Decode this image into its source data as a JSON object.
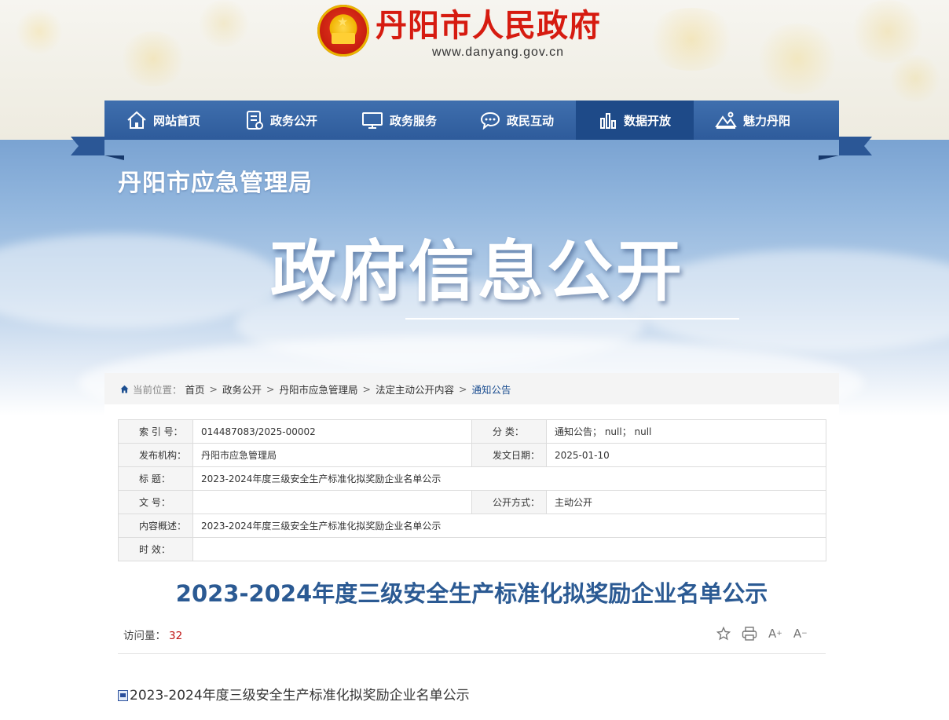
{
  "header": {
    "site_title": "丹阳市人民政府",
    "site_url": "www.danyang.gov.cn",
    "emblem_icon": "national-emblem-icon"
  },
  "nav": {
    "items": [
      {
        "label": "网站首页",
        "icon": "home-icon",
        "active": false
      },
      {
        "label": "政务公开",
        "icon": "document-icon",
        "active": false
      },
      {
        "label": "政务服务",
        "icon": "monitor-icon",
        "active": false
      },
      {
        "label": "政民互动",
        "icon": "chat-bubble-icon",
        "active": false
      },
      {
        "label": "数据开放",
        "icon": "bar-chart-icon",
        "active": true
      },
      {
        "label": "魅力丹阳",
        "icon": "landscape-icon",
        "active": false
      }
    ],
    "bg_color": "#2e5b9b",
    "active_color": "#1e4a88"
  },
  "banner": {
    "bureau_name": "丹阳市应急管理局",
    "title": "政府信息公开"
  },
  "breadcrumb": {
    "label": "当前位置：",
    "items": [
      "首页",
      "政务公开",
      "丹阳市应急管理局",
      "法定主动公开内容"
    ],
    "separator": ">",
    "current": "通知公告"
  },
  "meta": {
    "index_label": "索 引 号：",
    "index_value": "014487083/2025-00002",
    "category_label": "分 类：",
    "category_value": "通知公告； null； null",
    "publisher_label": "发布机构：",
    "publisher_value": "丹阳市应急管理局",
    "date_label": "发文日期：",
    "date_value": "2025-01-10",
    "title_label": "标 题：",
    "title_value": "2023-2024年度三级安全生产标准化拟奖励企业名单公示",
    "docno_label": "文 号：",
    "docno_value": "",
    "mode_label": "公开方式：",
    "mode_value": "主动公开",
    "summary_label": "内容概述：",
    "summary_value": "2023-2024年度三级安全生产标准化拟奖励企业名单公示",
    "validity_label": "时 效：",
    "validity_value": ""
  },
  "article": {
    "title": "2023-2024年度三级安全生产标准化拟奖励企业名单公示",
    "visits_label": "访问量：",
    "visits_value": "32",
    "font_increase": "A",
    "font_decrease": "A",
    "attachment": "2023-2024年度三级安全生产标准化拟奖励企业名单公示"
  }
}
